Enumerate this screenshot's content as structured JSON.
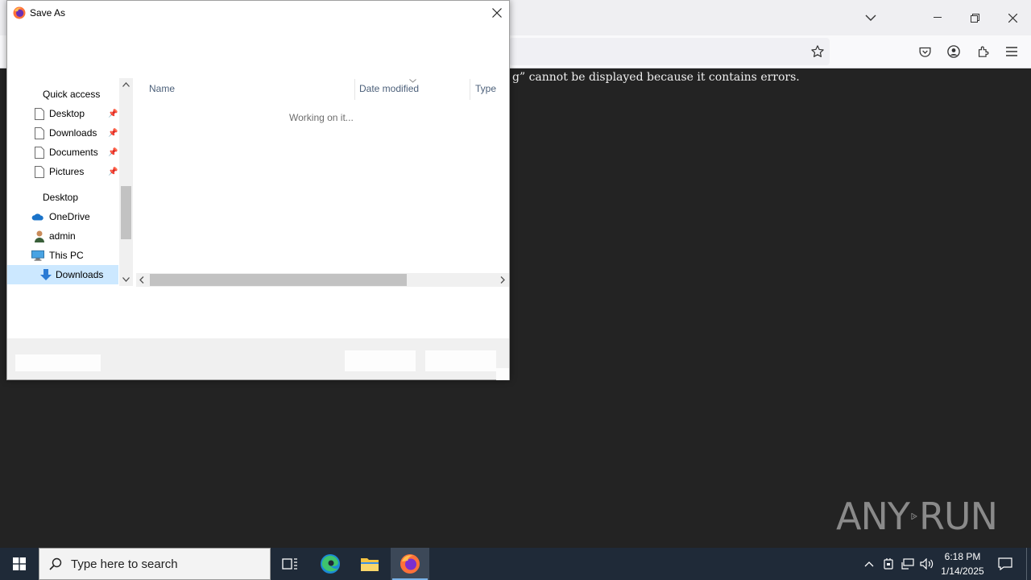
{
  "browser": {
    "error_message": "g” cannot be displayed because it contains errors."
  },
  "dialog": {
    "title": "Save As",
    "nav": {
      "quick_access": "Quick access",
      "items": [
        {
          "label": "Desktop",
          "pinned": true
        },
        {
          "label": "Downloads",
          "pinned": true
        },
        {
          "label": "Documents",
          "pinned": true
        },
        {
          "label": "Pictures",
          "pinned": true
        }
      ],
      "desktop": "Desktop",
      "tree": [
        {
          "label": "OneDrive",
          "icon": "onedrive-icon"
        },
        {
          "label": "admin",
          "icon": "user-icon"
        },
        {
          "label": "This PC",
          "icon": "computer-icon"
        },
        {
          "label": "Downloads",
          "icon": "download-arrow-icon",
          "selected": true
        }
      ]
    },
    "columns": [
      "Name",
      "Date modified",
      "Type"
    ],
    "status": "Working on it..."
  },
  "watermark": {
    "text_left": "ANY",
    "text_right": "RUN"
  },
  "taskbar": {
    "search_placeholder": "Type here to search",
    "time": "6:18 PM",
    "date": "1/14/2025"
  },
  "colors": {
    "accent": "#0078d7",
    "selected_row": "#cce8ff",
    "page_bg": "#232323",
    "taskbar_bg": "#1f2a38"
  }
}
